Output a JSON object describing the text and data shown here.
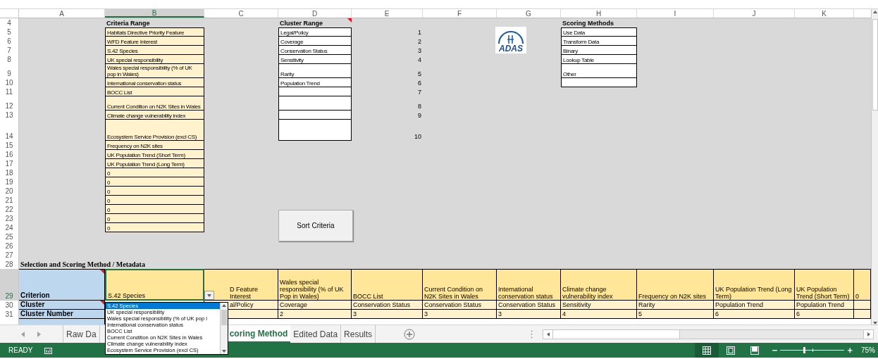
{
  "column_headers": [
    {
      "label": "A",
      "selected": false
    },
    {
      "label": "B",
      "selected": true
    },
    {
      "label": "C",
      "selected": false
    },
    {
      "label": "D",
      "selected": false
    },
    {
      "label": "E",
      "selected": false
    },
    {
      "label": "F",
      "selected": false
    },
    {
      "label": "G",
      "selected": false
    },
    {
      "label": "H",
      "selected": false
    },
    {
      "label": "I",
      "selected": false
    },
    {
      "label": "J",
      "selected": false
    },
    {
      "label": "K",
      "selected": false
    }
  ],
  "row_numbers": [
    {
      "label": "4",
      "selected": false
    },
    {
      "label": "5",
      "selected": false
    },
    {
      "label": "6",
      "selected": false
    },
    {
      "label": "7",
      "selected": false
    },
    {
      "label": "8",
      "selected": false
    },
    {
      "label": "9",
      "selected": false
    },
    {
      "label": "10",
      "selected": false
    },
    {
      "label": "11",
      "selected": false
    },
    {
      "label": "12",
      "selected": false
    },
    {
      "label": "13",
      "selected": false
    },
    {
      "label": "14",
      "selected": false
    },
    {
      "label": "15",
      "selected": false
    },
    {
      "label": "16",
      "selected": false
    },
    {
      "label": "17",
      "selected": false
    },
    {
      "label": "18",
      "selected": false
    },
    {
      "label": "19",
      "selected": false
    },
    {
      "label": "20",
      "selected": false
    },
    {
      "label": "21",
      "selected": false
    },
    {
      "label": "22",
      "selected": false
    },
    {
      "label": "23",
      "selected": false
    },
    {
      "label": "24",
      "selected": false
    },
    {
      "label": "25",
      "selected": false
    },
    {
      "label": "26",
      "selected": false
    },
    {
      "label": "27",
      "selected": false
    },
    {
      "label": "28",
      "selected": false
    },
    {
      "label": "29",
      "selected": true
    },
    {
      "label": "30",
      "selected": false
    },
    {
      "label": "31",
      "selected": false
    }
  ],
  "criteria_range": {
    "title": "Criteria Range",
    "items": [
      {
        "kind": "text",
        "text": "Habitats Directive Priority Feature"
      },
      {
        "kind": "text",
        "text": "WFD Feature Interest"
      },
      {
        "kind": "text",
        "text": "S.42 Species"
      },
      {
        "kind": "text",
        "text": "UK special responsibility"
      },
      {
        "kind": "text",
        "text": "Wales special responsibility (% of UK pop in Wales)"
      },
      {
        "kind": "text",
        "text": "International conservation status"
      },
      {
        "kind": "text",
        "text": "BOCC List"
      },
      {
        "kind": "text",
        "text": "Current Condition on N2K Sites in Wales"
      },
      {
        "kind": "text",
        "text": "Climate change vulnerability index"
      },
      {
        "kind": "text",
        "text": "Ecosystem Service Provision (excl CS)"
      },
      {
        "kind": "text",
        "text": "Frequency on N2K sites"
      },
      {
        "kind": "text",
        "text": "UK Population Trend (Short Term)"
      },
      {
        "kind": "text",
        "text": "UK Population Trend (Long Term)"
      },
      {
        "kind": "text",
        "text": "0"
      },
      {
        "kind": "text",
        "text": "0"
      },
      {
        "kind": "text",
        "text": "0"
      },
      {
        "kind": "text",
        "text": "0"
      },
      {
        "kind": "text",
        "text": "0"
      },
      {
        "kind": "text",
        "text": "0"
      },
      {
        "kind": "text",
        "text": "0"
      }
    ]
  },
  "cluster_range": {
    "title": "Cluster Range",
    "comment": true,
    "items": [
      {
        "kind": "text",
        "text": "Legal/Policy"
      },
      {
        "kind": "text",
        "text": "Coverage"
      },
      {
        "kind": "text",
        "text": "Conservation Status"
      },
      {
        "kind": "text",
        "text": "Sensitivity"
      },
      {
        "kind": "text",
        "text": "Rarity"
      },
      {
        "kind": "text",
        "text": "Population Trend"
      },
      {
        "kind": "blank"
      },
      {
        "kind": "blank"
      },
      {
        "kind": "blank"
      },
      {
        "kind": "blank"
      }
    ]
  },
  "cluster_numbers": [
    "1",
    "2",
    "3",
    "4",
    "5",
    "6",
    "7",
    "8",
    "9",
    "10"
  ],
  "logo": {
    "text": "ADAS"
  },
  "scoring_methods": {
    "title": "Scoring Methods",
    "items": [
      {
        "kind": "text",
        "text": "Use Data"
      },
      {
        "kind": "text",
        "text": "Transform Data"
      },
      {
        "kind": "text",
        "text": "Binary"
      },
      {
        "kind": "text",
        "text": "Lookup Table"
      },
      {
        "kind": "text",
        "text": "Other"
      },
      {
        "kind": "blank"
      }
    ]
  },
  "sort_button": "Sort Criteria",
  "section_title": "Selection and Scoring Method / Metadata",
  "metadata": {
    "header_label": {
      "text": "Criterion",
      "comment": true
    },
    "columns": [
      {
        "text": "S.42 Species",
        "selected": true
      },
      {
        "text": "D Feature Interest",
        "selected": false
      },
      {
        "text": "Wales special responsibility (% of UK Pop in Wales)",
        "selected": false
      },
      {
        "text": "BOCC List",
        "selected": false
      },
      {
        "text": "Current Condition on N2K Sites in Wales",
        "selected": false
      },
      {
        "text": "International conservation status",
        "selected": false
      },
      {
        "text": "Climate change vulnerability index",
        "selected": false
      },
      {
        "text": "Frequency on N2K sites",
        "selected": false
      },
      {
        "text": "UK Population Trend (Long Term)",
        "selected": false
      },
      {
        "text": "UK Population Trend (Short Term)",
        "selected": false
      },
      {
        "text": "0",
        "selected": false
      }
    ],
    "rows": [
      {
        "label": "Cluster",
        "comment": true,
        "cells": [
          null,
          "al/Policy",
          "Coverage",
          "Conservation Status",
          "Conservation Status",
          "Conservation Status",
          "Sensitivity",
          "Rarity",
          "Population Trend",
          "Population Trend",
          null
        ]
      },
      {
        "label": "Cluster Number",
        "cells": [
          null,
          null,
          "2",
          "3",
          "3",
          "3",
          "4",
          "5",
          "6",
          "6",
          null
        ]
      }
    ]
  },
  "dropdown": {
    "items": [
      {
        "label": "S.42 Species",
        "selected": true
      },
      {
        "label": "UK special responsibility",
        "selected": false
      },
      {
        "label": "Wales special responsibility (% of UK pop i",
        "selected": false
      },
      {
        "label": "International conservation status",
        "selected": false
      },
      {
        "label": "BOCC List",
        "selected": false
      },
      {
        "label": "Current Condition on N2K Sites in Wales",
        "selected": false
      },
      {
        "label": "Climate change vulnerability index",
        "selected": false
      },
      {
        "label": "Ecosystem Service Provision (excl CS)",
        "selected": false
      }
    ]
  },
  "sheet_tabs": [
    {
      "label": "Raw Da",
      "selected": false
    },
    {
      "label": "coring Method",
      "selected": true
    },
    {
      "label": "Edited Data",
      "selected": false
    },
    {
      "label": "Results",
      "selected": false
    }
  ],
  "status_bar": {
    "mode": "READY",
    "view_modes": [
      {
        "kind": "normal",
        "selected": true
      },
      {
        "kind": "page-layout",
        "selected": false
      },
      {
        "kind": "page-break",
        "selected": false
      }
    ],
    "zoom": {
      "out": "−",
      "in": "+",
      "level": 0.37,
      "reading": "75%"
    }
  }
}
